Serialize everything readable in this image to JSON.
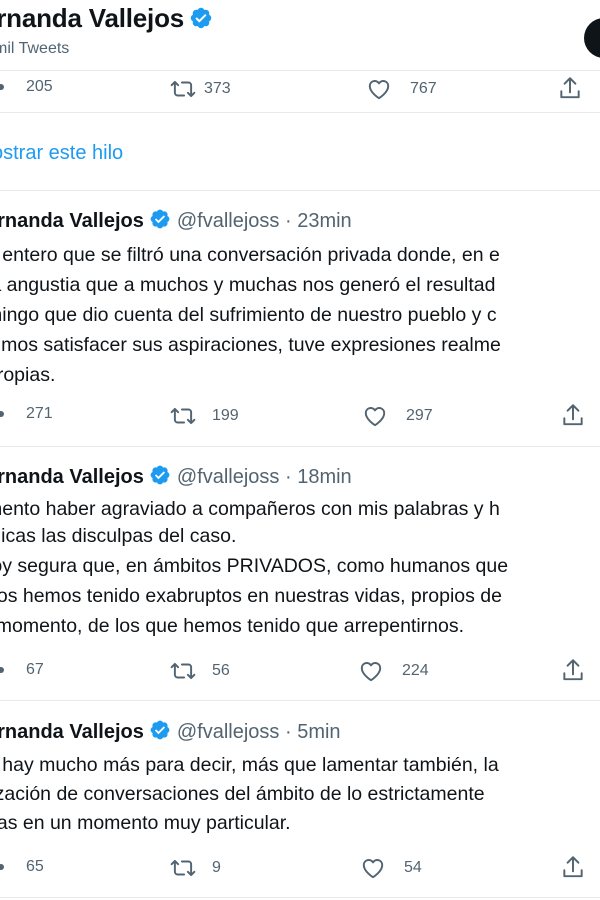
{
  "header": {
    "name": "ernanda Vallejos",
    "tweet_count": "mil Tweets"
  },
  "top_actions": {
    "replies": "205",
    "retweets": "373",
    "likes": "767"
  },
  "show_thread": "ostrar este hilo",
  "tweets": [
    {
      "name": "ernanda Vallejos",
      "handle": "@fvallejoss",
      "time": "· 23min",
      "lines": [
        "e entero que se filtró una conversación privada donde, en e",
        "la angustia que a muchos y muchas nos generó el resultad",
        "mingo que dio cuenta del sufrimiento de nuestro pueblo y c",
        "dimos satisfacer sus aspiraciones, tuve expresiones realme",
        "propias."
      ],
      "replies": "271",
      "retweets": "199",
      "likes": "297"
    },
    {
      "name": "ernanda Vallejos",
      "handle": "@fvallejoss",
      "time": "· 18min",
      "lines": [
        "mento haber agraviado a compañeros con mis palabras y h",
        "blicas las disculpas del caso.",
        "toy segura que, en ámbitos PRIVADOS, como humanos que",
        "dos hemos tenido exabruptos en nuestras vidas, propios de",
        "l momento, de los que hemos tenido que arrepentirnos."
      ],
      "replies": "67",
      "retweets": "56",
      "likes": "224"
    },
    {
      "name": "ernanda Vallejos",
      "handle": "@fvallejoss",
      "time": "· 5min",
      "lines": [
        "o hay mucho más para decir, más que lamentar también, la",
        "lización de conversaciones del ámbito de lo estrictamente",
        "das en un momento muy particular."
      ],
      "replies": "65",
      "retweets": "9",
      "likes": "54"
    }
  ],
  "colors": {
    "link": "#1d9bf0",
    "verified": "#1d9bf0",
    "secondary": "#536471",
    "divider": "#e7e9ea"
  },
  "icons": [
    "verified-badge-icon",
    "reply-icon",
    "retweet-icon",
    "like-icon",
    "share-icon"
  ]
}
